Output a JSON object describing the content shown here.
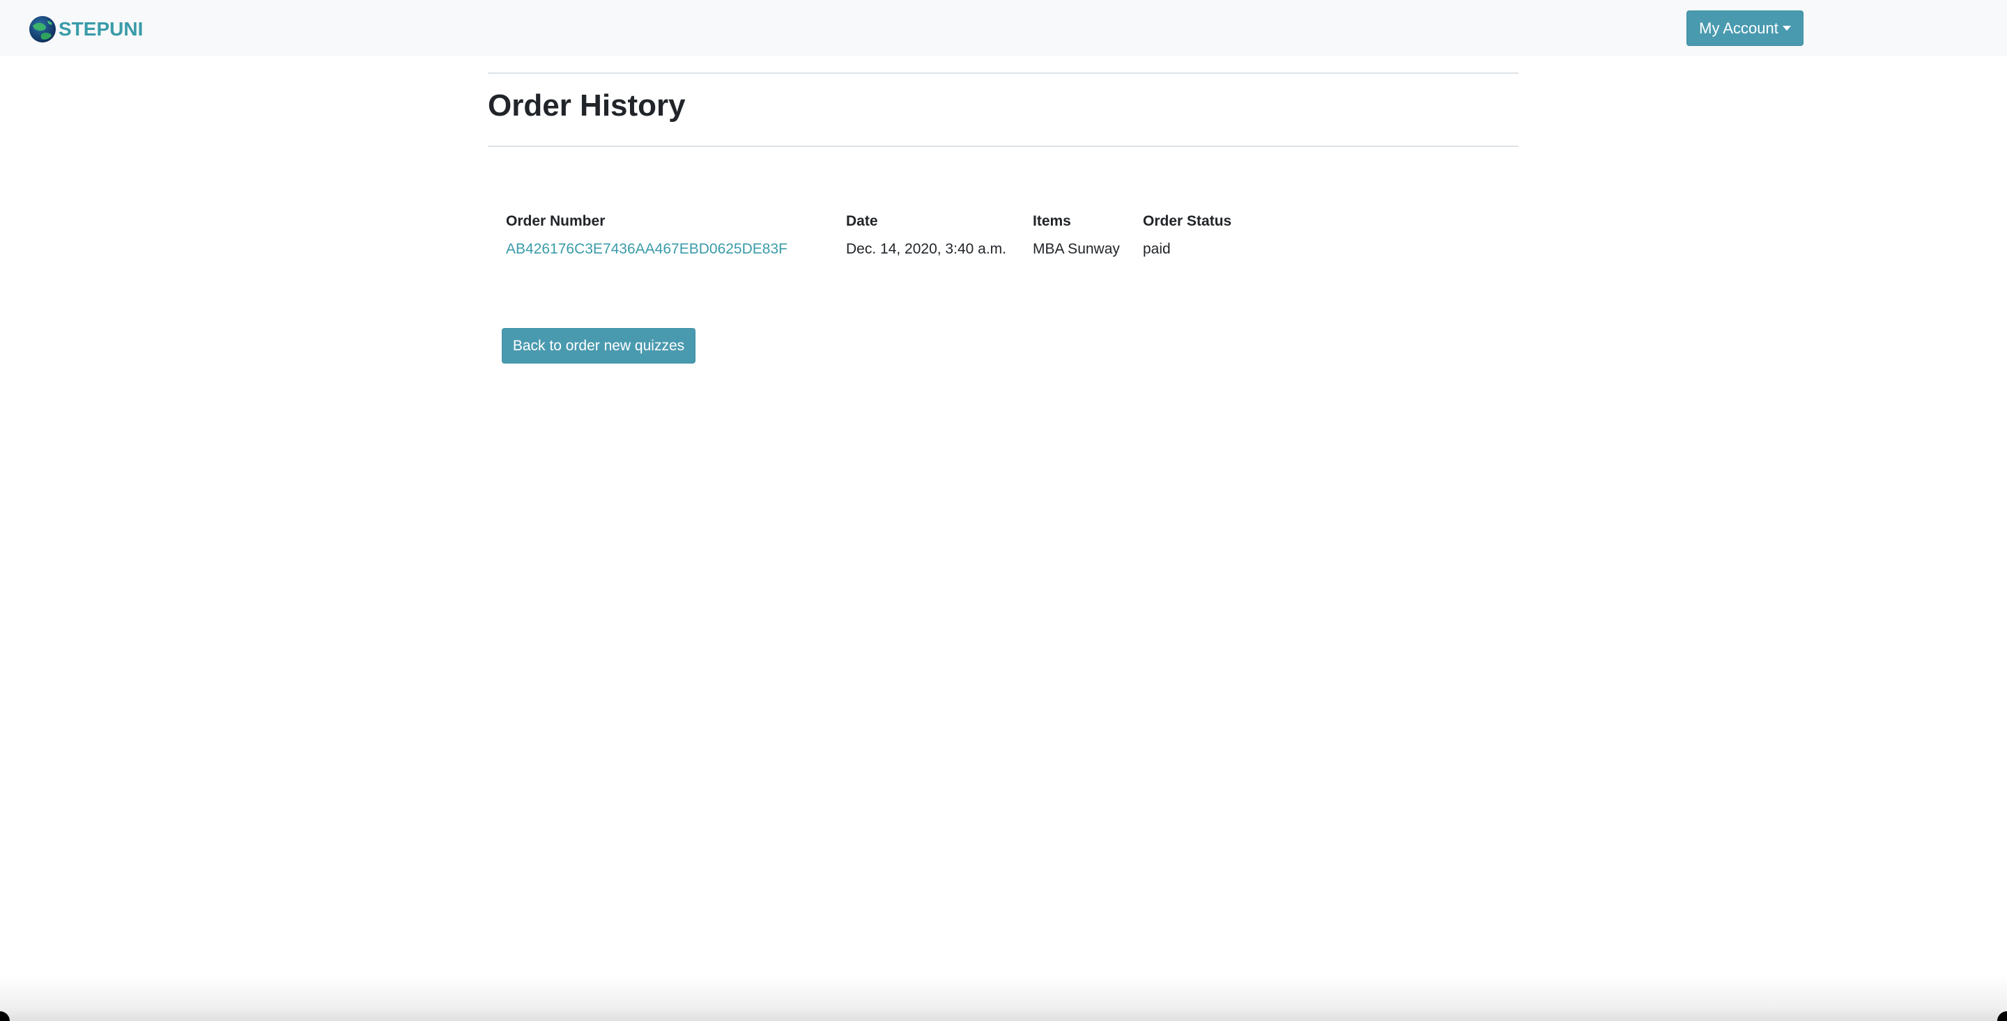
{
  "navbar": {
    "brand_text": "STEPUNI",
    "account_button_label": "My Account"
  },
  "page": {
    "title": "Order History"
  },
  "orders_table": {
    "columns": [
      "Order Number",
      "Date",
      "Items",
      "Order Status"
    ],
    "rows": [
      {
        "order_number": "AB426176C3E7436AA467EBD0625DE83F",
        "date": "Dec. 14, 2020, 3:40 a.m.",
        "items": "MBA Sunway",
        "status": "paid"
      }
    ]
  },
  "actions": {
    "back_button_label": "Back to order new quizzes"
  },
  "colors": {
    "accent": "#4a9aaf",
    "link": "#3a9ba9",
    "navbar_bg": "#f8f9fa"
  },
  "icons": {
    "brand_logo": "globe-logo-icon",
    "account_caret": "caret-down-icon"
  }
}
